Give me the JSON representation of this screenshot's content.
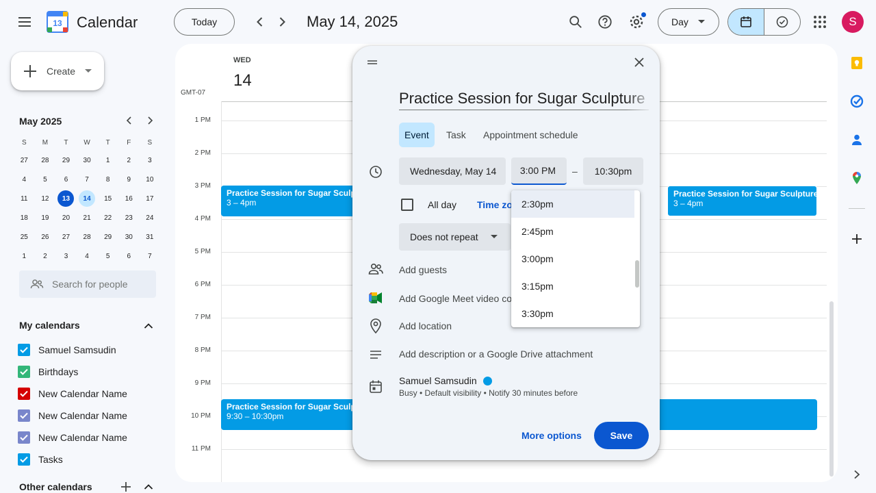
{
  "header": {
    "app_name": "Calendar",
    "logo_text": "13",
    "today_label": "Today",
    "date_title": "May 14, 2025",
    "view_label": "Day",
    "avatar_letter": "S",
    "avatar_color": "#d81b60"
  },
  "sidebar": {
    "create_label": "Create",
    "mini_cal_title": "May 2025",
    "dow": [
      "S",
      "M",
      "T",
      "W",
      "T",
      "F",
      "S"
    ],
    "weeks": [
      [
        "27",
        "28",
        "29",
        "30",
        "1",
        "2",
        "3"
      ],
      [
        "4",
        "5",
        "6",
        "7",
        "8",
        "9",
        "10"
      ],
      [
        "11",
        "12",
        "13",
        "14",
        "15",
        "16",
        "17"
      ],
      [
        "18",
        "19",
        "20",
        "21",
        "22",
        "23",
        "24"
      ],
      [
        "25",
        "26",
        "27",
        "28",
        "29",
        "30",
        "31"
      ],
      [
        "1",
        "2",
        "3",
        "4",
        "5",
        "6",
        "7"
      ]
    ],
    "search_placeholder": "Search for people",
    "my_calendars_title": "My calendars",
    "calendars": [
      {
        "label": "Samuel Samsudin",
        "color": "#039be5"
      },
      {
        "label": "Birthdays",
        "color": "#33b679"
      },
      {
        "label": "New Calendar Name",
        "color": "#d50000"
      },
      {
        "label": "New Calendar Name",
        "color": "#7986cb"
      },
      {
        "label": "New Calendar Name",
        "color": "#7986cb"
      },
      {
        "label": "Tasks",
        "color": "#039be5"
      }
    ],
    "other_calendars_title": "Other calendars"
  },
  "main": {
    "day_of_week": "WED",
    "day_number": "14",
    "timezone": "GMT-07",
    "hours": [
      "1 PM",
      "2 PM",
      "3 PM",
      "4 PM",
      "5 PM",
      "6 PM",
      "7 PM",
      "8 PM",
      "9 PM",
      "10 PM",
      "11 PM"
    ],
    "events": [
      {
        "title": "Practice Session for Sugar Sculpture",
        "time": "3 – 4pm"
      },
      {
        "title": "Practice Session for Sugar Sculpture",
        "time": "3 – 4pm"
      },
      {
        "title": "Practice Session for Sugar Sculpture",
        "time": "9:30 – 10:30pm"
      }
    ],
    "event_color": "#039be5"
  },
  "dialog": {
    "title_value": "Practice Session for Sugar Sculpture T",
    "tabs": [
      "Event",
      "Task",
      "Appointment schedule"
    ],
    "date_value": "Wednesday, May 14",
    "start_time": "3:00 PM",
    "dash": "–",
    "end_time": "10:30pm",
    "all_day_label": "All day",
    "time_zone_label": "Time zone",
    "repeat_value": "Does not repeat",
    "add_guests": "Add guests",
    "add_meet": "Add Google Meet video conferencing",
    "add_location": "Add location",
    "add_description": "Add description or a Google Drive attachment",
    "owner_name": "Samuel Samsudin",
    "owner_details": "Busy • Default visibility • Notify 30 minutes before",
    "more_options": "More options",
    "save": "Save",
    "time_options": [
      "2:30pm",
      "2:45pm",
      "3:00pm",
      "3:15pm",
      "3:30pm"
    ]
  }
}
